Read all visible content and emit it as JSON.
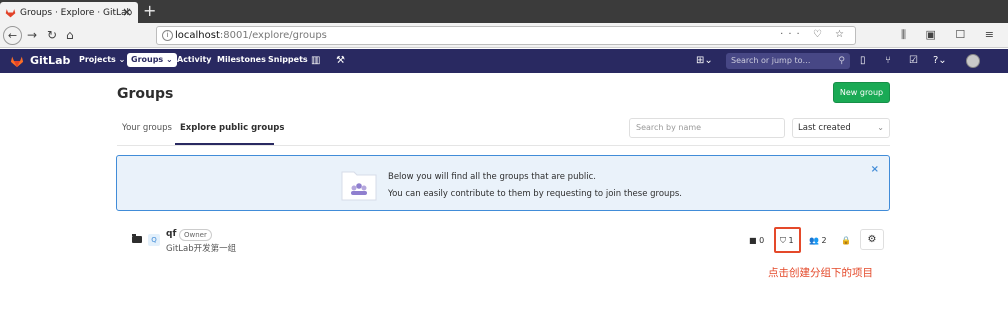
{
  "browser": {
    "tab_title": "Groups · Explore · GitLab",
    "url_host": "localhost",
    "url_path": ":8001/explore/groups"
  },
  "header": {
    "brand": "GitLab",
    "nav": [
      {
        "label": "Projects ⌄"
      },
      {
        "label": "Groups ⌄"
      },
      {
        "label": "Activity"
      },
      {
        "label": "Milestones"
      },
      {
        "label": "Snippets"
      }
    ],
    "search_placeholder": "Search or jump to…"
  },
  "page": {
    "title": "Groups",
    "new_group_label": "New group"
  },
  "tabs": [
    {
      "label": "Your groups"
    },
    {
      "label": "Explore public groups"
    }
  ],
  "filter": {
    "search_placeholder": "Search by name",
    "sort_value": "Last created"
  },
  "banner": {
    "line1": "Below you will find all the groups that are public.",
    "line2": "You can easily contribute to them by requesting to join these groups."
  },
  "groups": [
    {
      "avatar_letter": "Q",
      "name": "qf",
      "role": "Owner",
      "description": "GitLab开发第一组",
      "subgroups": "0",
      "projects": "1",
      "members": "2"
    }
  ],
  "annotation": "点击创建分组下的项目",
  "colors": {
    "header_bg": "#292961",
    "primary_green": "#1aaa55",
    "annotation_red": "#e4492a",
    "info_blue": "#418cd8"
  }
}
